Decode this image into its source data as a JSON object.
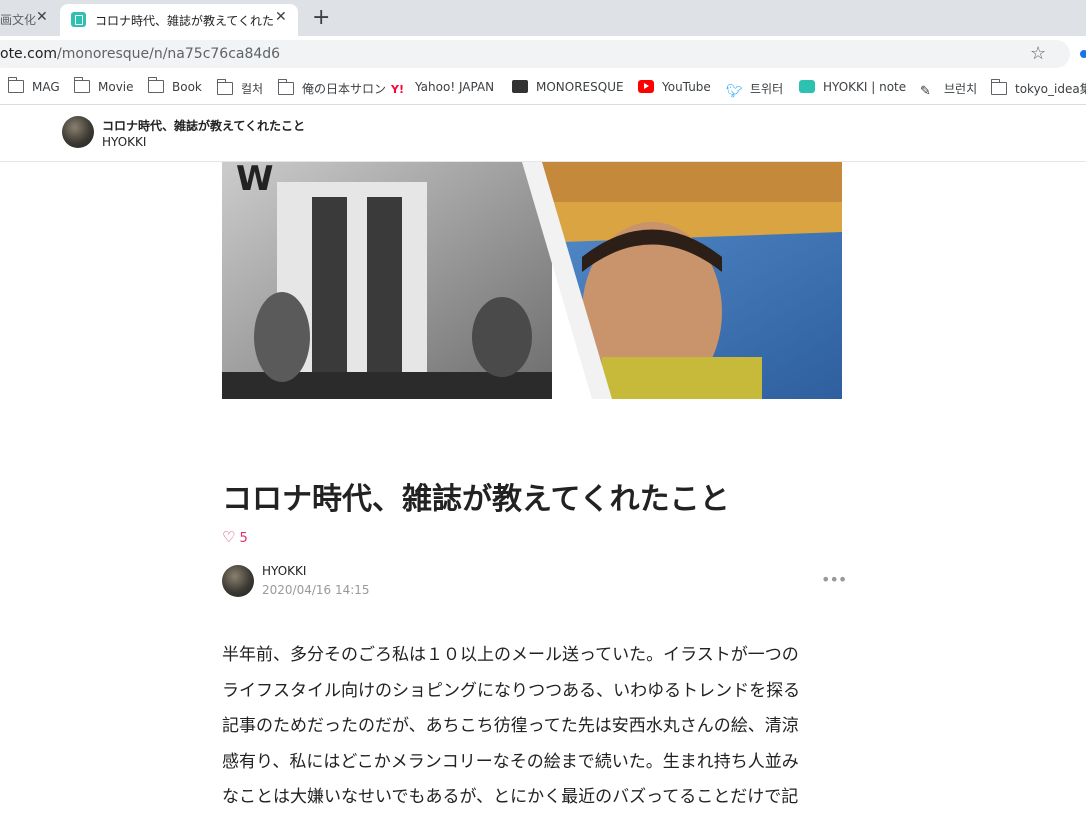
{
  "browser": {
    "tabs": [
      {
        "title": "画文化",
        "active": false
      },
      {
        "title": "コロナ時代、雑誌が教えてくれたこと",
        "active": true
      }
    ],
    "new_tab_icon": "+",
    "url_domain": "ote.com",
    "url_path": "/monoresque/n/na75c76ca84d6"
  },
  "bookmarks": [
    {
      "label": "MAG",
      "icon": "folder-icon"
    },
    {
      "label": "Movie",
      "icon": "folder-icon"
    },
    {
      "label": "Book",
      "icon": "folder-icon"
    },
    {
      "label": "컬처",
      "icon": "folder-icon"
    },
    {
      "label": "俺の日本サロン",
      "icon": "folder-icon"
    },
    {
      "label": "Yahoo! JAPAN",
      "icon": "yahoo-icon"
    },
    {
      "label": "MONORESQUE",
      "icon": "monoresque-icon"
    },
    {
      "label": "YouTube",
      "icon": "youtube-icon"
    },
    {
      "label": "트위터",
      "icon": "twitter-icon"
    },
    {
      "label": "HYOKKI | note",
      "icon": "note-icon"
    },
    {
      "label": "브런치",
      "icon": "pen-icon"
    },
    {
      "label": "tokyo_idea集",
      "icon": "folder-icon"
    }
  ],
  "header": {
    "title": "コロナ時代、雑誌が教えてくれたこと",
    "author": "HYOKKI"
  },
  "article": {
    "title": "コロナ時代、雑誌が教えてくれたこと",
    "likes": "5",
    "author": "HYOKKI",
    "date": "2020/04/16 14:15",
    "body": [
      "半年前、多分そのごろ私は１０以上のメール送っていた。イラストが一つの",
      "ライフスタイル向けのショピングになりつつある、いわゆるトレンドを探る",
      "記事のためだったのだが、あちこち彷徨ってた先は安西水丸さんの絵、清涼",
      "感有り、私にはどこかメランコリーなその絵まで続いた。生まれ持ち人並み",
      "なことは大嫌いなせいでもあるが、とにかく最近のバズってることだけで記"
    ]
  },
  "colors": {
    "note_green": "#2cc1b1",
    "like_pink": "#e1306c"
  }
}
